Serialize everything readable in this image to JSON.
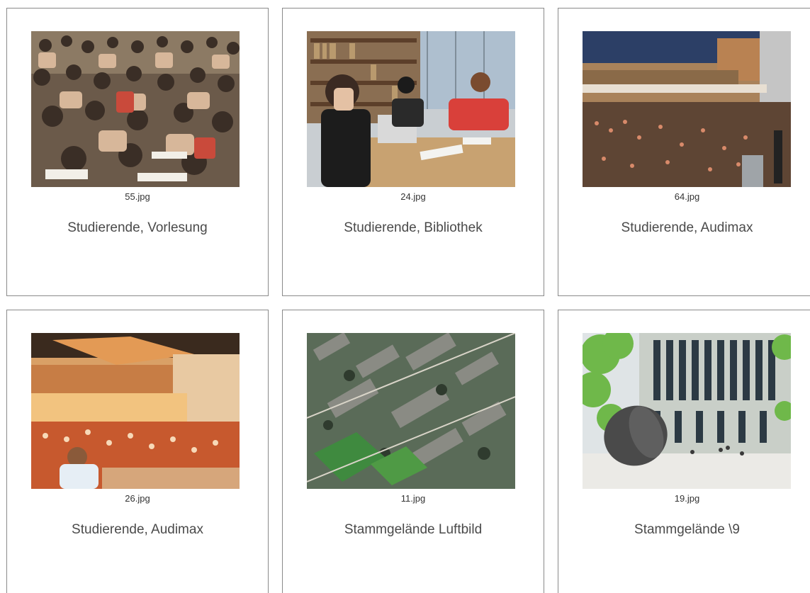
{
  "gallery": {
    "items": [
      {
        "filename": "55.jpg",
        "caption": "Studierende, Vorlesung",
        "image": "lecture-students-photo"
      },
      {
        "filename": "24.jpg",
        "caption": "Studierende, Bibliothek",
        "image": "library-students-photo"
      },
      {
        "filename": "64.jpg",
        "caption": "Studierende, Audimax",
        "image": "audimax-hall-photo"
      },
      {
        "filename": "26.jpg",
        "caption": "Studierende, Audimax",
        "image": "audimax-lecture-photo"
      },
      {
        "filename": "11.jpg",
        "caption": "Stammgelände Luftbild",
        "image": "aerial-campus-photo"
      },
      {
        "filename": "19.jpg",
        "caption": "Stammgelände \\9",
        "image": "campus-building-sculpture-photo"
      }
    ]
  },
  "colors": {
    "border": "#8a8a8a",
    "caption": "#4a4a4a",
    "filename": "#333333"
  }
}
